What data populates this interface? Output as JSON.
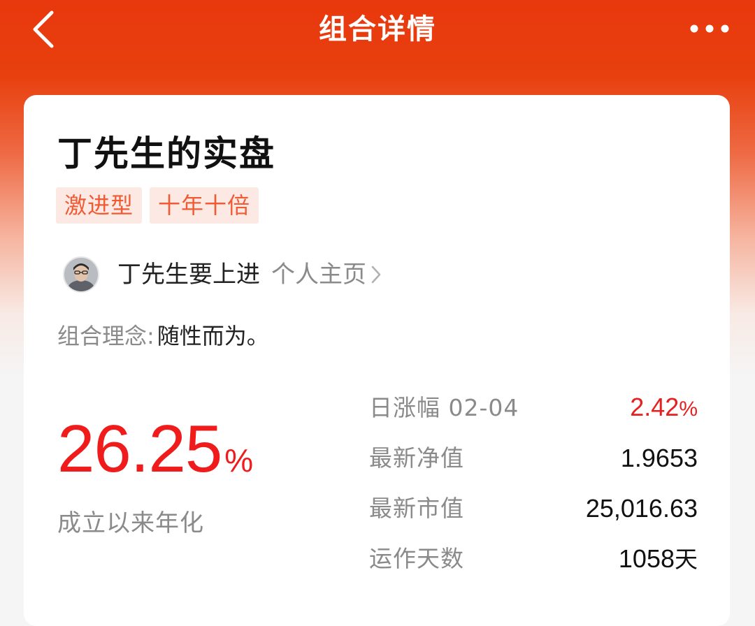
{
  "nav": {
    "title": "组合详情",
    "back_icon": "chevron-left-icon",
    "more_icon": "more-dots-icon"
  },
  "portfolio": {
    "title": "丁先生的实盘",
    "tags": [
      "激进型",
      "十年十倍"
    ],
    "author": {
      "name": "丁先生要上进",
      "homepage_label": "个人主页"
    },
    "philosophy": {
      "label": "组合理念:",
      "text": "随性而为。"
    },
    "annualized": {
      "value": "26.25",
      "unit": "%",
      "label": "成立以来年化"
    },
    "stats": {
      "daily_change": {
        "label": "日涨幅 02-04",
        "value": "2.42",
        "unit": "%"
      },
      "latest_nav": {
        "label": "最新净值",
        "value": "1.9653"
      },
      "market_value": {
        "label": "最新市值",
        "value": "25,016.63"
      },
      "running_days": {
        "label": "运作天数",
        "value": "1058",
        "unit": "天"
      }
    }
  },
  "colors": {
    "header_red": "#e8380d",
    "accent_red": "#f01b1b",
    "tag_bg": "#fde9e3",
    "tag_text": "#ef5b34"
  }
}
